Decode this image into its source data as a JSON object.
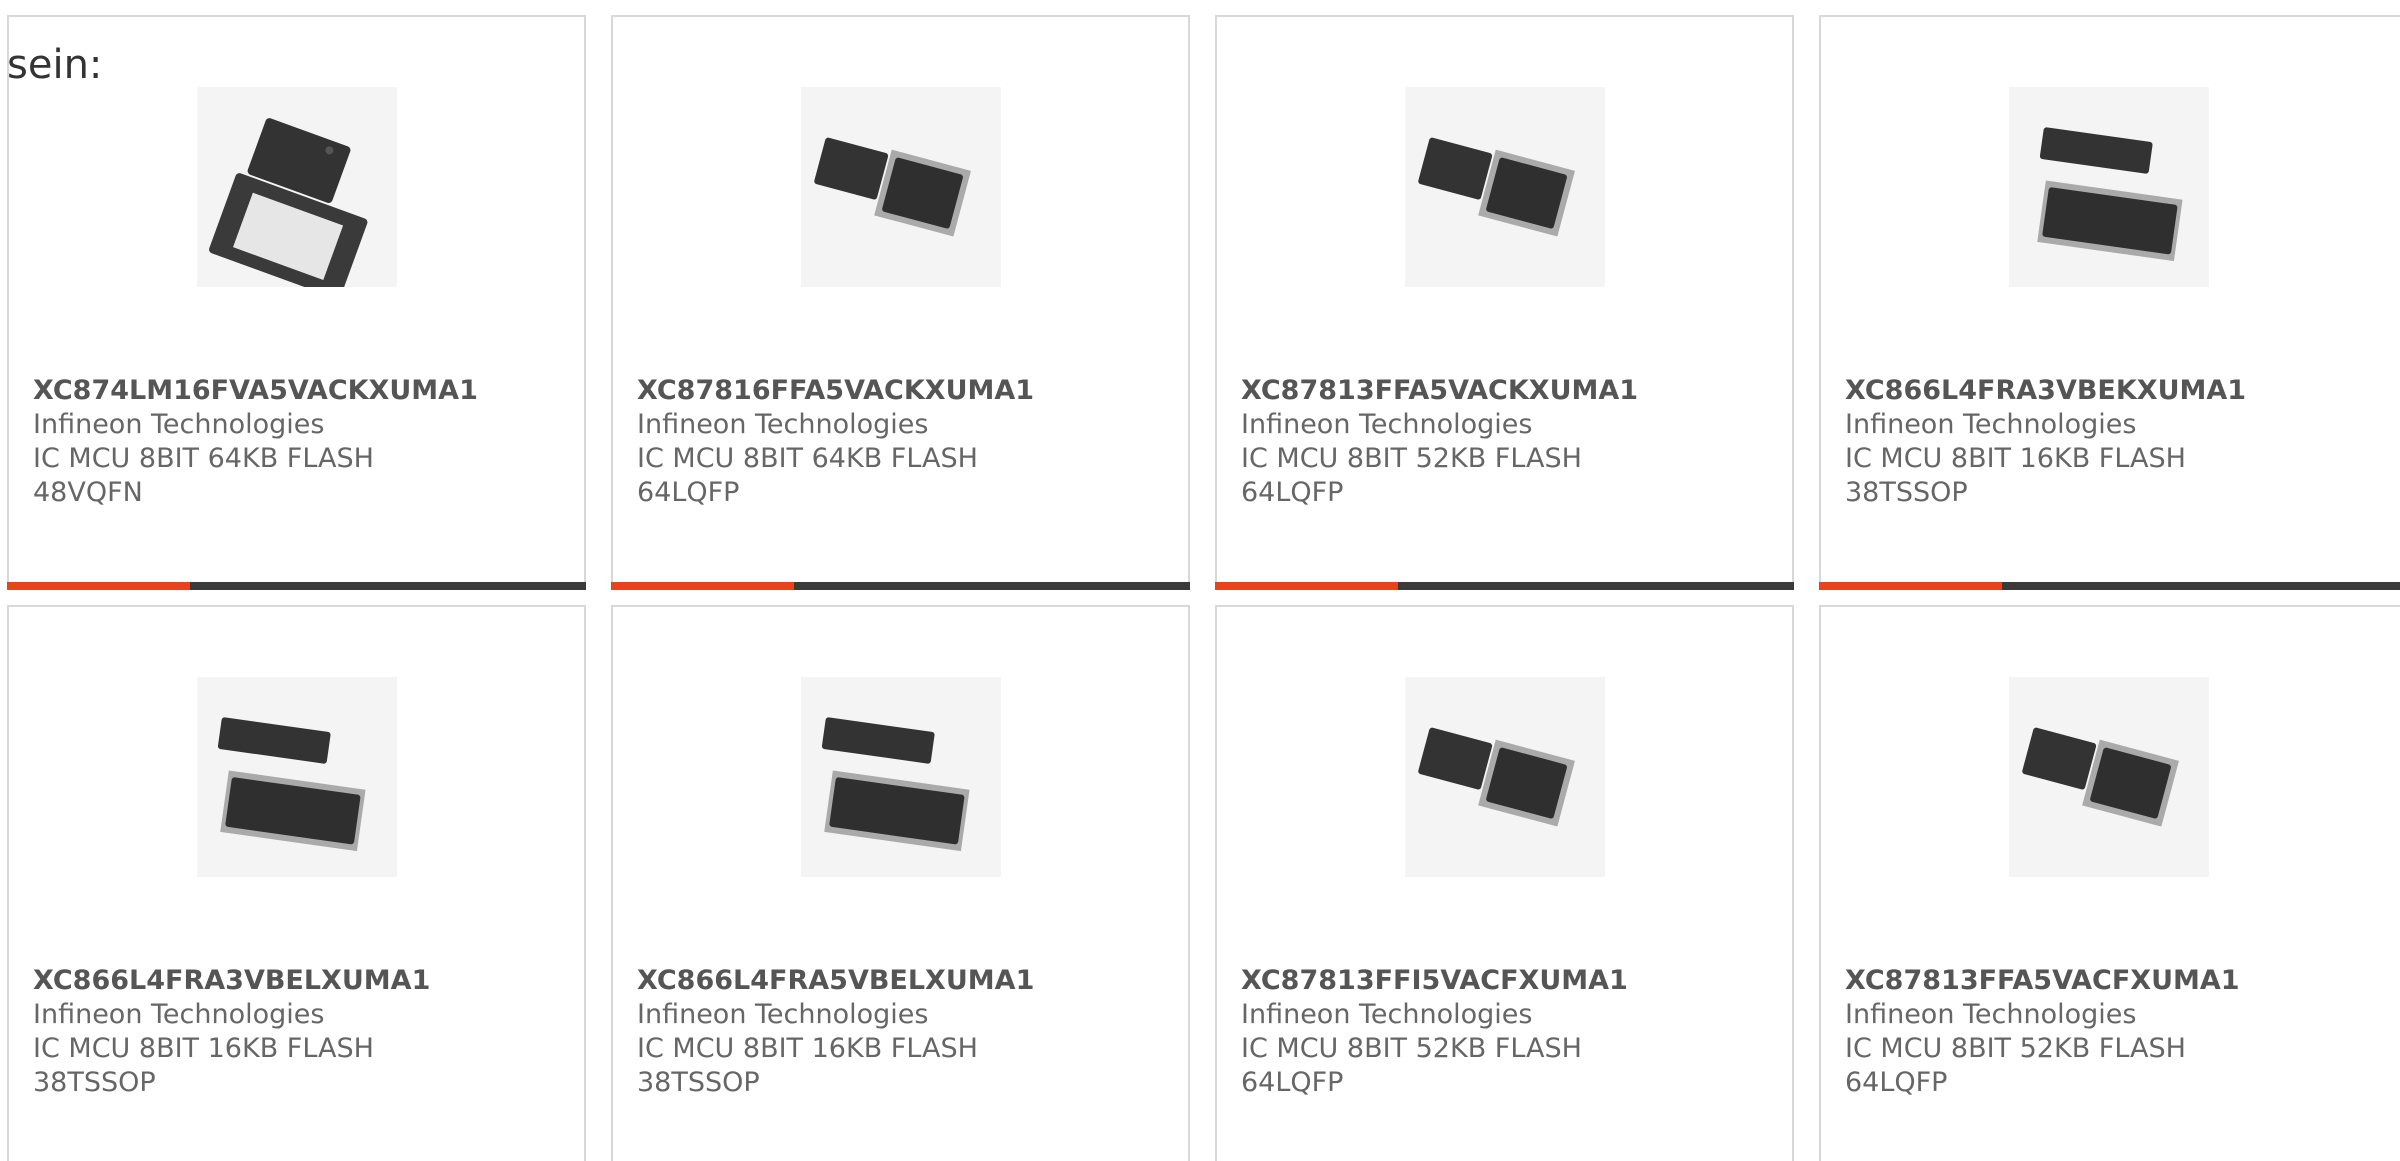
{
  "intro_text": "sein:",
  "colors": {
    "accent": "#e8431b",
    "bar": "#3a3a3a",
    "border": "#d8d8d8"
  },
  "products": [
    {
      "part": "XC874LM16FVA5VACKXUMA1",
      "manufacturer": "Infineon Technologies",
      "desc_line1": "IC MCU 8BIT 64KB FLASH",
      "desc_line2": "48VQFN",
      "image_icon": "qfn-package-icon"
    },
    {
      "part": "XC87816FFA5VACKXUMA1",
      "manufacturer": "Infineon Technologies",
      "desc_line1": "IC MCU 8BIT 64KB FLASH",
      "desc_line2": "64LQFP",
      "image_icon": "lqfp-package-icon"
    },
    {
      "part": "XC87813FFA5VACKXUMA1",
      "manufacturer": "Infineon Technologies",
      "desc_line1": "IC MCU 8BIT 52KB FLASH",
      "desc_line2": "64LQFP",
      "image_icon": "lqfp-package-icon"
    },
    {
      "part": "XC866L4FRA3VBEKXUMA1",
      "manufacturer": "Infineon Technologies",
      "desc_line1": "IC MCU 8BIT 16KB FLASH",
      "desc_line2": "38TSSOP",
      "image_icon": "tssop-package-icon"
    },
    {
      "part": "XC866L4FRA3VBELXUMA1",
      "manufacturer": "Infineon Technologies",
      "desc_line1": "IC MCU 8BIT 16KB FLASH",
      "desc_line2": "38TSSOP",
      "image_icon": "tssop-package-icon"
    },
    {
      "part": "XC866L4FRA5VBELXUMA1",
      "manufacturer": "Infineon Technologies",
      "desc_line1": "IC MCU 8BIT 16KB FLASH",
      "desc_line2": "38TSSOP",
      "image_icon": "tssop-package-icon"
    },
    {
      "part": "XC87813FFI5VACFXUMA1",
      "manufacturer": "Infineon Technologies",
      "desc_line1": "IC MCU 8BIT 52KB FLASH",
      "desc_line2": "64LQFP",
      "image_icon": "lqfp-package-icon"
    },
    {
      "part": "XC87813FFA5VACFXUMA1",
      "manufacturer": "Infineon Technologies",
      "desc_line1": "IC MCU 8BIT 52KB FLASH",
      "desc_line2": "64LQFP",
      "image_icon": "lqfp-package-icon"
    }
  ]
}
